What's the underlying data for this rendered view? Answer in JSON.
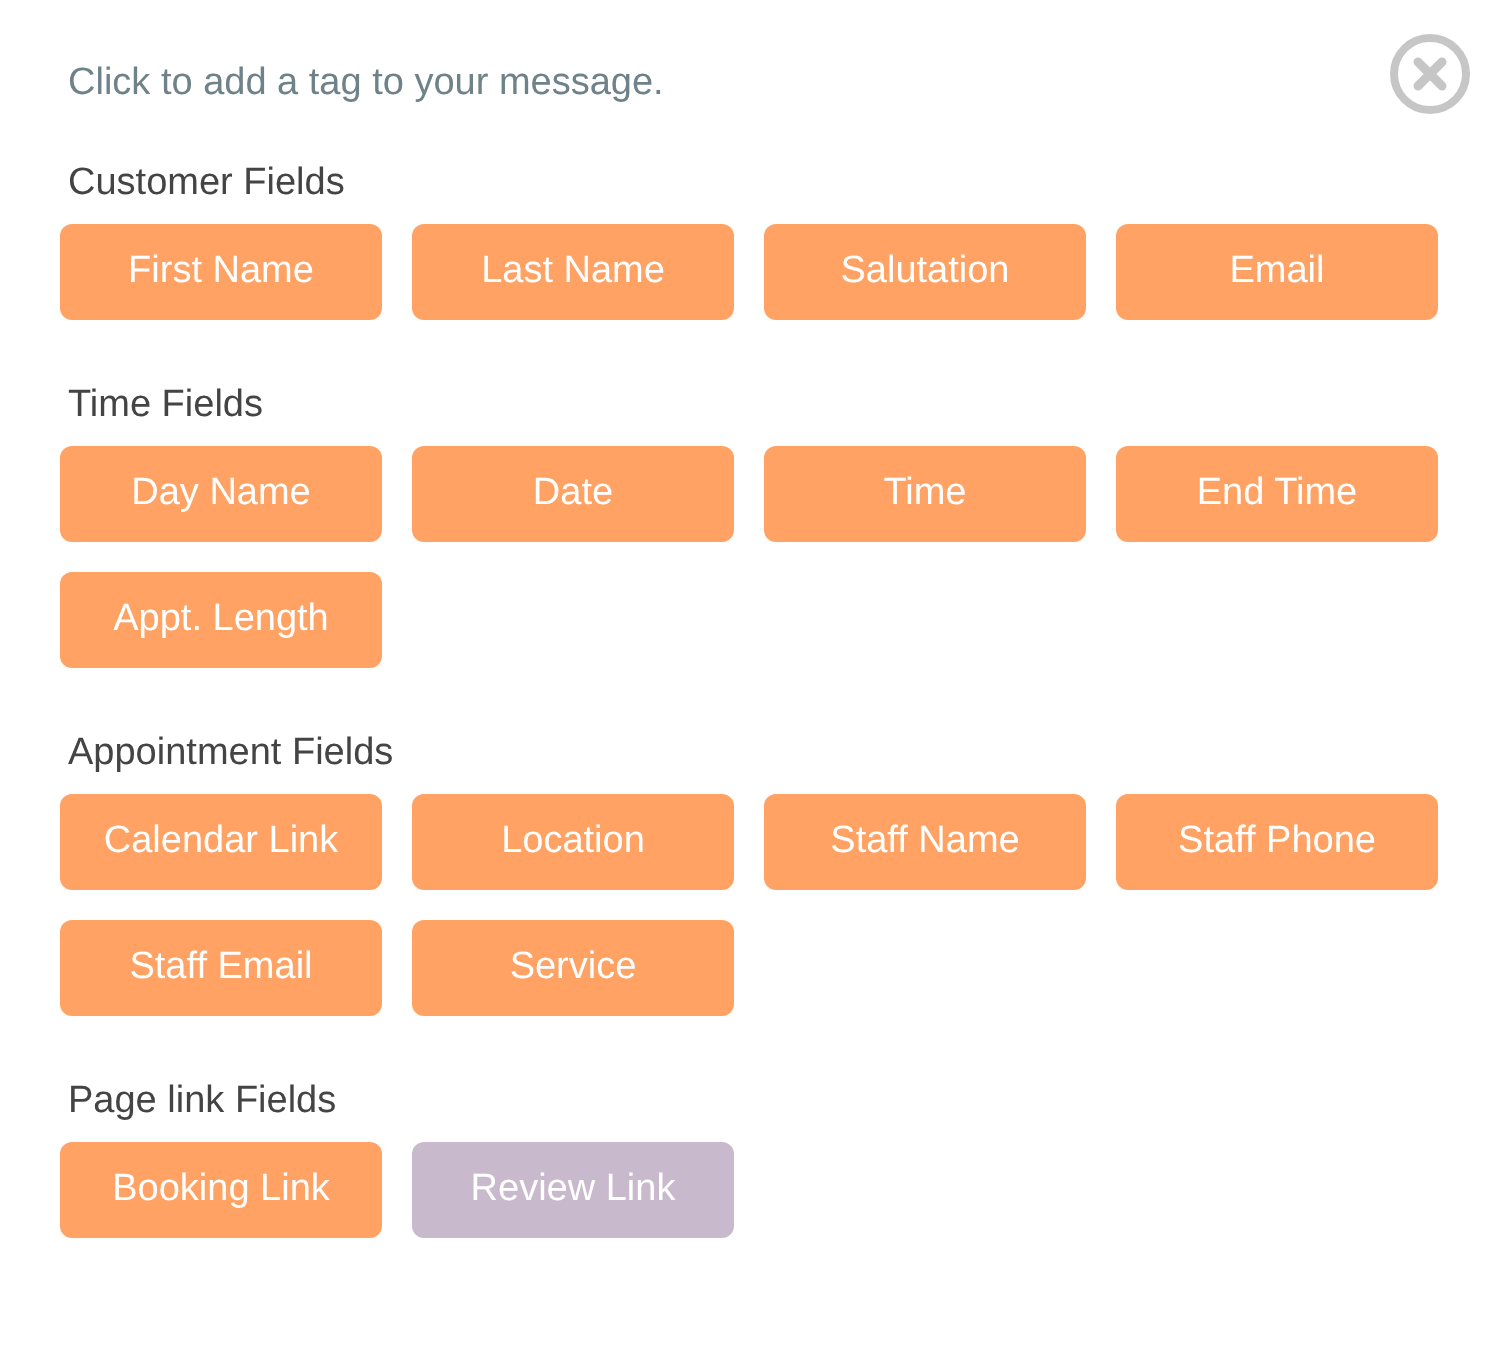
{
  "intro": "Click to add a tag to your message.",
  "sections": [
    {
      "heading": "Customer Fields",
      "tags": [
        {
          "label": "First Name",
          "disabled": false
        },
        {
          "label": "Last Name",
          "disabled": false
        },
        {
          "label": "Salutation",
          "disabled": false
        },
        {
          "label": "Email",
          "disabled": false
        }
      ]
    },
    {
      "heading": "Time Fields",
      "tags": [
        {
          "label": "Day Name",
          "disabled": false
        },
        {
          "label": "Date",
          "disabled": false
        },
        {
          "label": "Time",
          "disabled": false
        },
        {
          "label": "End Time",
          "disabled": false
        },
        {
          "label": "Appt. Length",
          "disabled": false
        }
      ]
    },
    {
      "heading": "Appointment Fields",
      "tags": [
        {
          "label": "Calendar Link",
          "disabled": false
        },
        {
          "label": "Location",
          "disabled": false
        },
        {
          "label": "Staff Name",
          "disabled": false
        },
        {
          "label": "Staff Phone",
          "disabled": false
        },
        {
          "label": "Staff Email",
          "disabled": false
        },
        {
          "label": "Service",
          "disabled": false
        }
      ]
    },
    {
      "heading": "Page link Fields",
      "tags": [
        {
          "label": "Booking Link",
          "disabled": false
        },
        {
          "label": "Review Link",
          "disabled": true
        }
      ]
    }
  ]
}
